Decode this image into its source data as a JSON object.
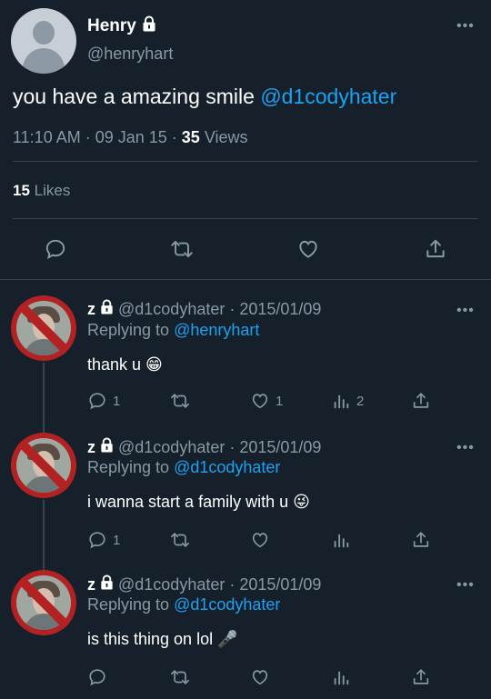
{
  "main": {
    "name": "Henry",
    "handle": "@henryhart",
    "text_before": "you have a amazing smile ",
    "mention": "@d1codyhater",
    "meta_time": "11:10 AM · 09 Jan 15 · ",
    "views_count": "35",
    "views_label": " Views",
    "likes_count": "15",
    "likes_label": " Likes"
  },
  "replies": [
    {
      "name": "z",
      "handle_date": "@d1codyhater · 2015/01/09",
      "replying_label": "Replying to ",
      "replying_to": "@henryhart",
      "text": "thank u 😁",
      "reply_count": "1",
      "like_count": "1",
      "views_count": "2"
    },
    {
      "name": "z",
      "handle_date": "@d1codyhater · 2015/01/09",
      "replying_label": "Replying to ",
      "replying_to": "@d1codyhater",
      "text": "i wanna start a family with u 😜",
      "reply_count": "1"
    },
    {
      "name": "z",
      "handle_date": "@d1codyhater · 2015/01/09",
      "replying_label": "Replying to ",
      "replying_to": "@d1codyhater",
      "text": "is this thing on lol 🎤"
    }
  ],
  "colors": {
    "background": "#15202b",
    "accent": "#1da1f2",
    "muted": "#8899a6",
    "divider": "#38444d"
  },
  "icons": [
    "lock-icon",
    "more-icon",
    "reply-icon",
    "retweet-icon",
    "like-icon",
    "share-icon",
    "views-icon"
  ]
}
